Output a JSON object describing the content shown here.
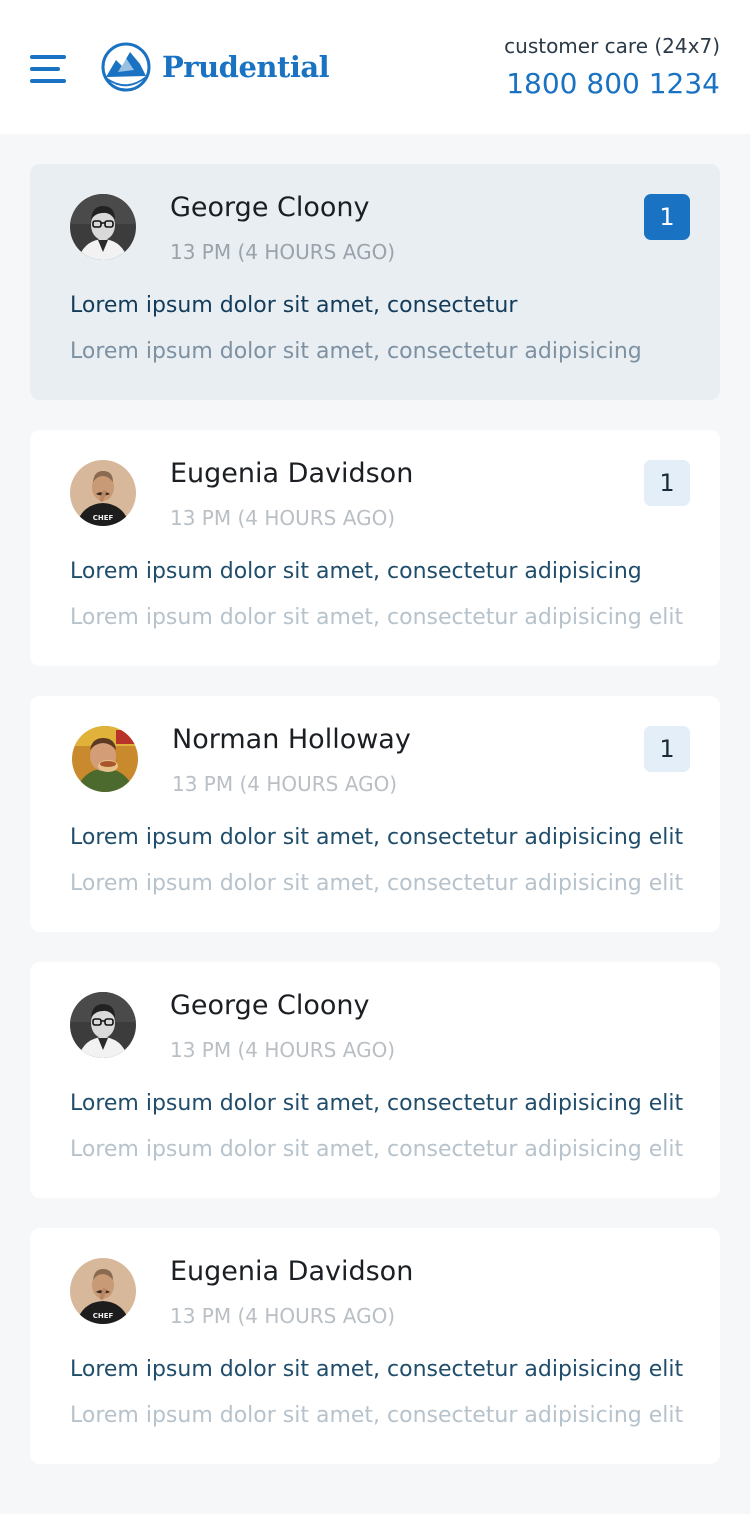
{
  "header": {
    "menu_icon": "hamburger-menu-icon",
    "brand": "Prudential",
    "brand_color": "#1a73c2",
    "customer_care_label": "customer care (24x7)",
    "customer_care_phone": "1800 800 1234"
  },
  "messages": [
    {
      "name": "George Cloony",
      "time": "13 PM (4 HOURS AGO)",
      "unread": "1",
      "preview": "Lorem ipsum dolor sit amet, consectetur",
      "subtext": "Lorem ipsum dolor sit amet, consectetur adipisicing",
      "avatar": "avatar-george"
    },
    {
      "name": "Eugenia Davidson",
      "time": "13 PM (4 HOURS AGO)",
      "unread": "1",
      "preview": "Lorem ipsum dolor sit amet, consectetur adipisicing",
      "subtext": "Lorem ipsum dolor sit amet, consectetur adipisicing elit",
      "avatar": "avatar-eugenia"
    },
    {
      "name": "Norman Holloway",
      "time": "13 PM (4 HOURS AGO)",
      "unread": "1",
      "preview": "Lorem ipsum dolor sit amet, consectetur adipisicing elit",
      "subtext": "Lorem ipsum dolor sit amet, consectetur adipisicing elit",
      "avatar": "avatar-norman"
    },
    {
      "name": "George Cloony",
      "time": "13 PM (4 HOURS AGO)",
      "preview": "Lorem ipsum dolor sit amet, consectetur adipisicing elit",
      "subtext": "Lorem ipsum dolor sit amet, consectetur adipisicing elit",
      "avatar": "avatar-george"
    },
    {
      "name": "Eugenia Davidson",
      "time": "13 PM (4 HOURS AGO)",
      "preview": "Lorem ipsum dolor sit amet, consectetur adipisicing elit",
      "subtext": "Lorem ipsum dolor sit amet, consectetur adipisicing elit",
      "avatar": "avatar-eugenia"
    }
  ]
}
